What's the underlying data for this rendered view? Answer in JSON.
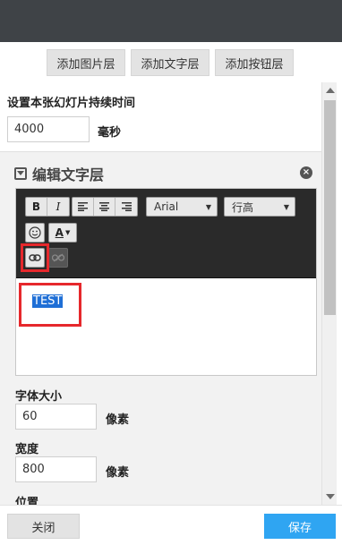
{
  "header": {
    "color": "#3f4347"
  },
  "add_buttons": {
    "image_layer": "添加图片层",
    "text_layer": "添加文字层",
    "button_layer": "添加按钮层"
  },
  "slide": {
    "duration_label": "设置本张幻灯片持续时间",
    "duration_value": "4000",
    "duration_unit": "毫秒"
  },
  "text_layer_panel": {
    "title": "编辑文字层",
    "toolbar": {
      "bold": "B",
      "italic": "I",
      "font_family": "Arial",
      "line_height": "行高",
      "font_color": "A",
      "icons": [
        "bold-icon",
        "italic-icon",
        "align-left-icon",
        "align-center-icon",
        "align-right-icon",
        "emoji-icon",
        "font-color-icon",
        "link-icon",
        "unlink-icon"
      ]
    },
    "content_text": "TEST",
    "font_size_label": "字体大小",
    "font_size_value": "60",
    "font_size_unit": "像素",
    "width_label": "宽度",
    "width_value": "800",
    "width_unit": "像素",
    "position_label": "位置"
  },
  "footer": {
    "close_label": "关闭",
    "save_label": "保存",
    "save_color": "#2fa5f2"
  },
  "highlight_color": "#e6282c"
}
